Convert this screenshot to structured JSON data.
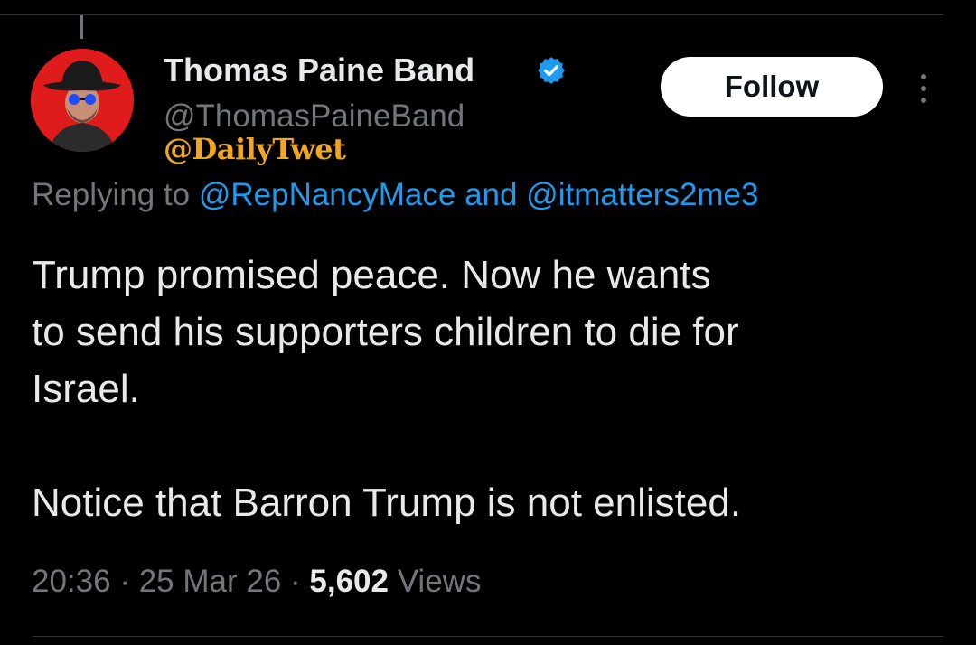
{
  "author": {
    "display_name": "Thomas Paine Band",
    "handle": "@ThomasPaineBand",
    "verified_color": "#1d9bf0"
  },
  "watermark": "@DailyTwet",
  "follow_button": {
    "label": "Follow"
  },
  "more_menu": {
    "icon": "more-vertical-icon"
  },
  "reply": {
    "prefix": "Replying to ",
    "mention_1": "@RepNancyMace",
    "conjunction": " and ",
    "mention_2": "@itmatters2me3"
  },
  "tweet": {
    "lines": [
      "Trump promised peace. Now he wants",
      "to send his supporters children to die for",
      "Israel.",
      "Notice that Barron Trump is not enlisted."
    ]
  },
  "meta": {
    "time": "20:36",
    "separator": " · ",
    "date": "25 Mar 26",
    "views_count": "5,602",
    "views_label": " Views"
  },
  "colors": {
    "background": "#000000",
    "text": "#e7e9ea",
    "secondary": "#71767b",
    "link": "#1d9bf0",
    "watermark": "#f2a71b",
    "avatar_bg": "#e01b1b"
  }
}
